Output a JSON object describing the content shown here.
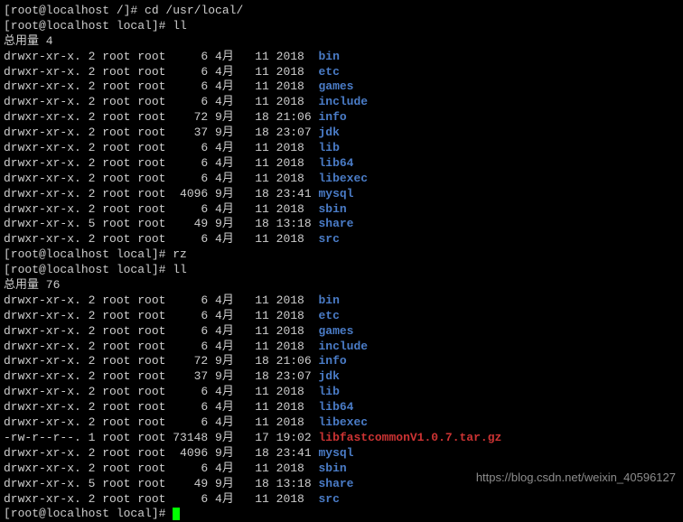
{
  "prompts": {
    "p1": "[root@localhost /]# ",
    "p2": "[root@localhost local]# "
  },
  "commands": {
    "cd": "cd /usr/local/",
    "ll": "ll",
    "rz": "rz"
  },
  "header1": "总用量 4",
  "header2": "总用量 76",
  "chart_data": [
    {
      "section": "first_listing",
      "entries": [
        {
          "perm": "drwxr-xr-x.",
          "links": "2",
          "owner": "root",
          "group": "root",
          "size": "6",
          "month": "4月",
          "day": "11",
          "time": "2018",
          "name": "bin",
          "cls": "dir"
        },
        {
          "perm": "drwxr-xr-x.",
          "links": "2",
          "owner": "root",
          "group": "root",
          "size": "6",
          "month": "4月",
          "day": "11",
          "time": "2018",
          "name": "etc",
          "cls": "dir"
        },
        {
          "perm": "drwxr-xr-x.",
          "links": "2",
          "owner": "root",
          "group": "root",
          "size": "6",
          "month": "4月",
          "day": "11",
          "time": "2018",
          "name": "games",
          "cls": "dir"
        },
        {
          "perm": "drwxr-xr-x.",
          "links": "2",
          "owner": "root",
          "group": "root",
          "size": "6",
          "month": "4月",
          "day": "11",
          "time": "2018",
          "name": "include",
          "cls": "dir"
        },
        {
          "perm": "drwxr-xr-x.",
          "links": "2",
          "owner": "root",
          "group": "root",
          "size": "72",
          "month": "9月",
          "day": "18",
          "time": "21:06",
          "name": "info",
          "cls": "dir"
        },
        {
          "perm": "drwxr-xr-x.",
          "links": "2",
          "owner": "root",
          "group": "root",
          "size": "37",
          "month": "9月",
          "day": "18",
          "time": "23:07",
          "name": "jdk",
          "cls": "dir"
        },
        {
          "perm": "drwxr-xr-x.",
          "links": "2",
          "owner": "root",
          "group": "root",
          "size": "6",
          "month": "4月",
          "day": "11",
          "time": "2018",
          "name": "lib",
          "cls": "dir"
        },
        {
          "perm": "drwxr-xr-x.",
          "links": "2",
          "owner": "root",
          "group": "root",
          "size": "6",
          "month": "4月",
          "day": "11",
          "time": "2018",
          "name": "lib64",
          "cls": "dir"
        },
        {
          "perm": "drwxr-xr-x.",
          "links": "2",
          "owner": "root",
          "group": "root",
          "size": "6",
          "month": "4月",
          "day": "11",
          "time": "2018",
          "name": "libexec",
          "cls": "dir"
        },
        {
          "perm": "drwxr-xr-x.",
          "links": "2",
          "owner": "root",
          "group": "root",
          "size": "4096",
          "month": "9月",
          "day": "18",
          "time": "23:41",
          "name": "mysql",
          "cls": "dir"
        },
        {
          "perm": "drwxr-xr-x.",
          "links": "2",
          "owner": "root",
          "group": "root",
          "size": "6",
          "month": "4月",
          "day": "11",
          "time": "2018",
          "name": "sbin",
          "cls": "dir"
        },
        {
          "perm": "drwxr-xr-x.",
          "links": "5",
          "owner": "root",
          "group": "root",
          "size": "49",
          "month": "9月",
          "day": "18",
          "time": "13:18",
          "name": "share",
          "cls": "dir"
        },
        {
          "perm": "drwxr-xr-x.",
          "links": "2",
          "owner": "root",
          "group": "root",
          "size": "6",
          "month": "4月",
          "day": "11",
          "time": "2018",
          "name": "src",
          "cls": "dir"
        }
      ]
    },
    {
      "section": "second_listing",
      "entries": [
        {
          "perm": "drwxr-xr-x.",
          "links": "2",
          "owner": "root",
          "group": "root",
          "size": "6",
          "month": "4月",
          "day": "11",
          "time": "2018",
          "name": "bin",
          "cls": "dir"
        },
        {
          "perm": "drwxr-xr-x.",
          "links": "2",
          "owner": "root",
          "group": "root",
          "size": "6",
          "month": "4月",
          "day": "11",
          "time": "2018",
          "name": "etc",
          "cls": "dir"
        },
        {
          "perm": "drwxr-xr-x.",
          "links": "2",
          "owner": "root",
          "group": "root",
          "size": "6",
          "month": "4月",
          "day": "11",
          "time": "2018",
          "name": "games",
          "cls": "dir"
        },
        {
          "perm": "drwxr-xr-x.",
          "links": "2",
          "owner": "root",
          "group": "root",
          "size": "6",
          "month": "4月",
          "day": "11",
          "time": "2018",
          "name": "include",
          "cls": "dir"
        },
        {
          "perm": "drwxr-xr-x.",
          "links": "2",
          "owner": "root",
          "group": "root",
          "size": "72",
          "month": "9月",
          "day": "18",
          "time": "21:06",
          "name": "info",
          "cls": "dir"
        },
        {
          "perm": "drwxr-xr-x.",
          "links": "2",
          "owner": "root",
          "group": "root",
          "size": "37",
          "month": "9月",
          "day": "18",
          "time": "23:07",
          "name": "jdk",
          "cls": "dir"
        },
        {
          "perm": "drwxr-xr-x.",
          "links": "2",
          "owner": "root",
          "group": "root",
          "size": "6",
          "month": "4月",
          "day": "11",
          "time": "2018",
          "name": "lib",
          "cls": "dir"
        },
        {
          "perm": "drwxr-xr-x.",
          "links": "2",
          "owner": "root",
          "group": "root",
          "size": "6",
          "month": "4月",
          "day": "11",
          "time": "2018",
          "name": "lib64",
          "cls": "dir"
        },
        {
          "perm": "drwxr-xr-x.",
          "links": "2",
          "owner": "root",
          "group": "root",
          "size": "6",
          "month": "4月",
          "day": "11",
          "time": "2018",
          "name": "libexec",
          "cls": "dir"
        },
        {
          "perm": "-rw-r--r--.",
          "links": "1",
          "owner": "root",
          "group": "root",
          "size": "73148",
          "month": "9月",
          "day": "17",
          "time": "19:02",
          "name": "libfastcommonV1.0.7.tar.gz",
          "cls": "archive"
        },
        {
          "perm": "drwxr-xr-x.",
          "links": "2",
          "owner": "root",
          "group": "root",
          "size": "4096",
          "month": "9月",
          "day": "18",
          "time": "23:41",
          "name": "mysql",
          "cls": "dir"
        },
        {
          "perm": "drwxr-xr-x.",
          "links": "2",
          "owner": "root",
          "group": "root",
          "size": "6",
          "month": "4月",
          "day": "11",
          "time": "2018",
          "name": "sbin",
          "cls": "dir"
        },
        {
          "perm": "drwxr-xr-x.",
          "links": "5",
          "owner": "root",
          "group": "root",
          "size": "49",
          "month": "9月",
          "day": "18",
          "time": "13:18",
          "name": "share",
          "cls": "dir"
        },
        {
          "perm": "drwxr-xr-x.",
          "links": "2",
          "owner": "root",
          "group": "root",
          "size": "6",
          "month": "4月",
          "day": "11",
          "time": "2018",
          "name": "src",
          "cls": "dir"
        }
      ]
    }
  ],
  "watermark": "https://blog.csdn.net/weixin_40596127"
}
